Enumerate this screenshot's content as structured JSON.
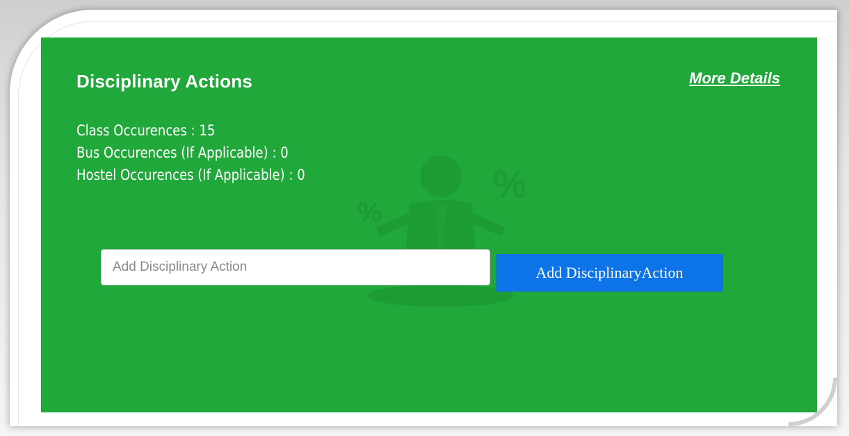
{
  "card": {
    "title": "Disciplinary Actions",
    "more_link": "More Details",
    "background_color": "#21a83a",
    "stats": [
      "Class Occurences : 15",
      "Bus Occurences (If Applicable) : 0",
      "Hostel Occurences (If Applicable) : 0"
    ],
    "watermark_icon": "business-person-balance-icon"
  },
  "form": {
    "input_placeholder": "Add Disciplinary Action",
    "input_value": "",
    "button_label": "Add DisciplinaryAction",
    "button_color": "#0d73e8"
  }
}
